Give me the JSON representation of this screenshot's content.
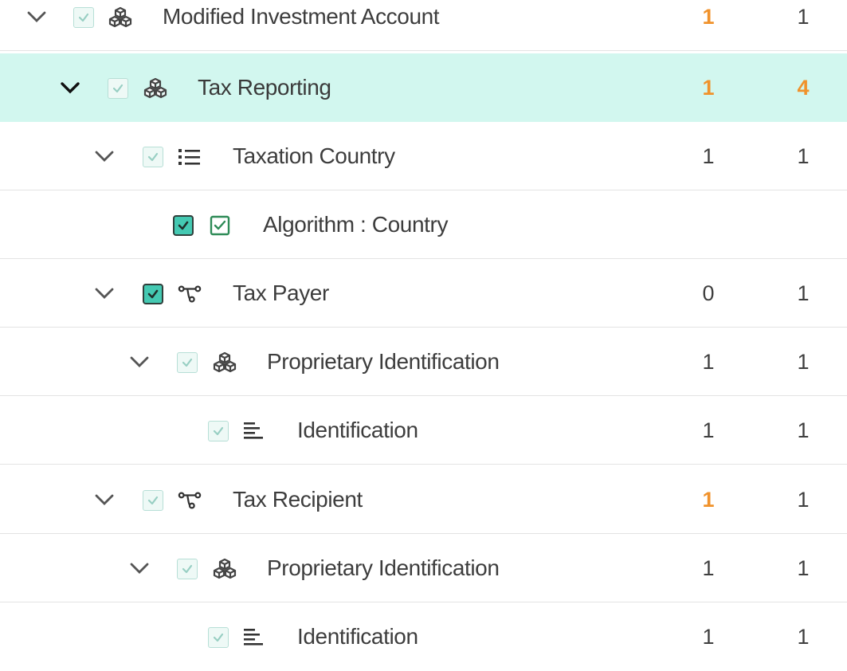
{
  "rows": [
    {
      "label": "Modified Investment Account",
      "type": "group",
      "expanded": true,
      "checkbox": "light",
      "col1": "1",
      "col1_warn": true,
      "col2": "1",
      "col2_warn": false,
      "selected": false
    },
    {
      "label": "Tax Reporting",
      "type": "group",
      "expanded": true,
      "checkbox": "light",
      "col1": "1",
      "col1_warn": true,
      "col2": "4",
      "col2_warn": true,
      "selected": true
    },
    {
      "label": "Taxation Country",
      "type": "list",
      "expanded": true,
      "checkbox": "light",
      "col1": "1",
      "col1_warn": false,
      "col2": "1",
      "col2_warn": false,
      "selected": false
    },
    {
      "label": "Algorithm : Country",
      "type": "algorithm",
      "expanded": null,
      "checkbox": "strong",
      "col1": "",
      "col1_warn": false,
      "col2": "",
      "col2_warn": false,
      "selected": false
    },
    {
      "label": "Tax Payer",
      "type": "choice",
      "expanded": true,
      "checkbox": "strong",
      "col1": "0",
      "col1_warn": false,
      "col2": "1",
      "col2_warn": false,
      "selected": false
    },
    {
      "label": "Proprietary Identification",
      "type": "group",
      "expanded": true,
      "checkbox": "light",
      "col1": "1",
      "col1_warn": false,
      "col2": "1",
      "col2_warn": false,
      "selected": false
    },
    {
      "label": "Identification",
      "type": "text",
      "expanded": null,
      "checkbox": "light",
      "col1": "1",
      "col1_warn": false,
      "col2": "1",
      "col2_warn": false,
      "selected": false
    },
    {
      "label": "Tax Recipient",
      "type": "choice",
      "expanded": true,
      "checkbox": "light",
      "col1": "1",
      "col1_warn": true,
      "col2": "1",
      "col2_warn": false,
      "selected": false
    },
    {
      "label": "Proprietary Identification",
      "type": "group",
      "expanded": true,
      "checkbox": "light",
      "col1": "1",
      "col1_warn": false,
      "col2": "1",
      "col2_warn": false,
      "selected": false
    },
    {
      "label": "Identification",
      "type": "text",
      "expanded": null,
      "checkbox": "light",
      "col1": "1",
      "col1_warn": false,
      "col2": "1",
      "col2_warn": false,
      "selected": false
    }
  ],
  "icons": {
    "group": "group-icon",
    "list": "list-icon",
    "algorithm": "algorithm-check-icon",
    "choice": "choice-branch-icon",
    "text": "text-field-icon"
  },
  "colors": {
    "selected_row": "#d2f7ef",
    "warning_number": "#f0922b",
    "checkbox_strong": "#44c9b2",
    "checkbox_light": "#eef9f6",
    "algorithm_icon": "#2e8b57"
  }
}
